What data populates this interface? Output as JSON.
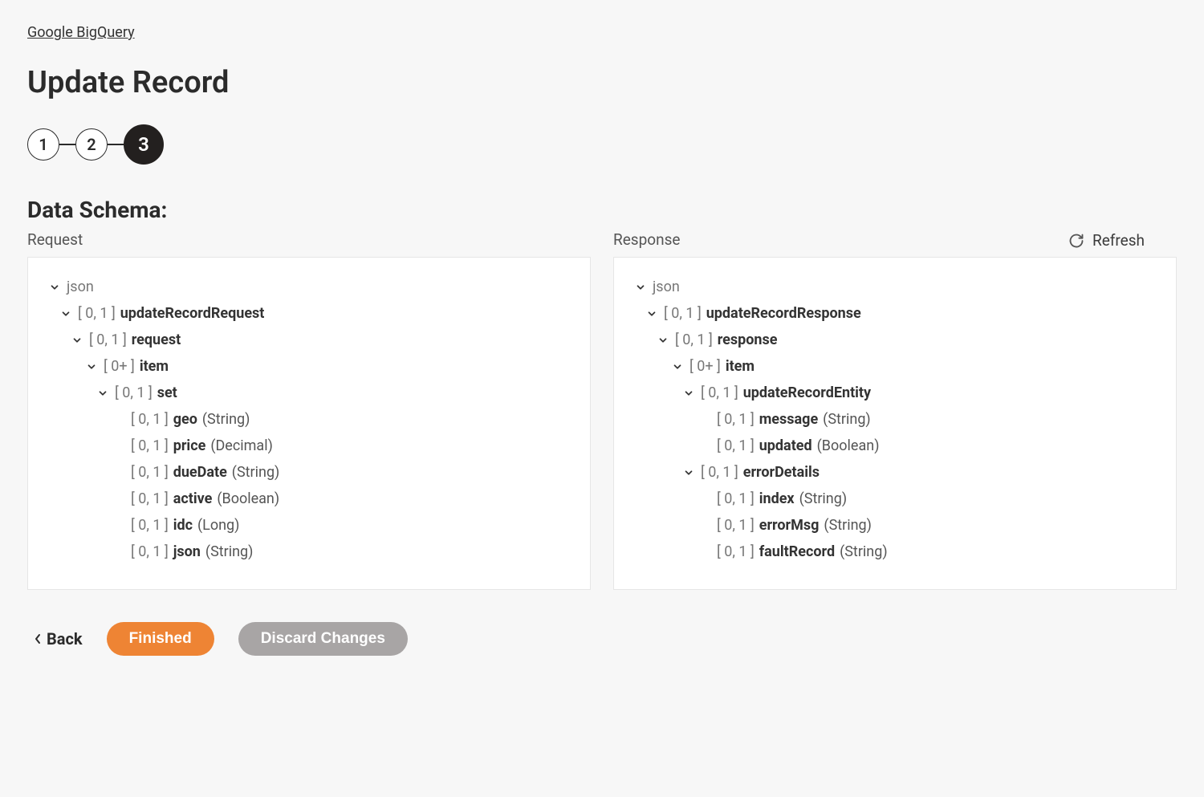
{
  "breadcrumb": "Google BigQuery",
  "page_title": "Update Record",
  "stepper": {
    "steps": [
      "1",
      "2",
      "3"
    ],
    "active_index": 2
  },
  "section_title": "Data Schema:",
  "refresh_label": "Refresh",
  "columns": {
    "request": {
      "label": "Request",
      "root": "json",
      "tree": [
        {
          "depth": 1,
          "card": "[ 0, 1 ]",
          "name": "updateRecordRequest",
          "expandable": true
        },
        {
          "depth": 2,
          "card": "[ 0, 1 ]",
          "name": "request",
          "expandable": true
        },
        {
          "depth": 3,
          "card": "[ 0+ ]",
          "name": "item",
          "expandable": true
        },
        {
          "depth": 4,
          "card": "[ 0, 1 ]",
          "name": "set",
          "expandable": true
        },
        {
          "depth": 5,
          "card": "[ 0, 1 ]",
          "name": "geo",
          "type": "(String)"
        },
        {
          "depth": 5,
          "card": "[ 0, 1 ]",
          "name": "price",
          "type": "(Decimal)"
        },
        {
          "depth": 5,
          "card": "[ 0, 1 ]",
          "name": "dueDate",
          "type": "(String)"
        },
        {
          "depth": 5,
          "card": "[ 0, 1 ]",
          "name": "active",
          "type": "(Boolean)"
        },
        {
          "depth": 5,
          "card": "[ 0, 1 ]",
          "name": "idc",
          "type": "(Long)"
        },
        {
          "depth": 5,
          "card": "[ 0, 1 ]",
          "name": "json",
          "type": "(String)"
        }
      ]
    },
    "response": {
      "label": "Response",
      "root": "json",
      "tree": [
        {
          "depth": 1,
          "card": "[ 0, 1 ]",
          "name": "updateRecordResponse",
          "expandable": true
        },
        {
          "depth": 2,
          "card": "[ 0, 1 ]",
          "name": "response",
          "expandable": true
        },
        {
          "depth": 3,
          "card": "[ 0+ ]",
          "name": "item",
          "expandable": true
        },
        {
          "depth": 4,
          "card": "[ 0, 1 ]",
          "name": "updateRecordEntity",
          "expandable": true
        },
        {
          "depth": 5,
          "card": "[ 0, 1 ]",
          "name": "message",
          "type": "(String)"
        },
        {
          "depth": 5,
          "card": "[ 0, 1 ]",
          "name": "updated",
          "type": "(Boolean)"
        },
        {
          "depth": 4,
          "card": "[ 0, 1 ]",
          "name": "errorDetails",
          "expandable": true
        },
        {
          "depth": 5,
          "card": "[ 0, 1 ]",
          "name": "index",
          "type": "(String)"
        },
        {
          "depth": 5,
          "card": "[ 0, 1 ]",
          "name": "errorMsg",
          "type": "(String)"
        },
        {
          "depth": 5,
          "card": "[ 0, 1 ]",
          "name": "faultRecord",
          "type": "(String)"
        }
      ]
    }
  },
  "buttons": {
    "back": "Back",
    "finished": "Finished",
    "discard": "Discard Changes"
  }
}
